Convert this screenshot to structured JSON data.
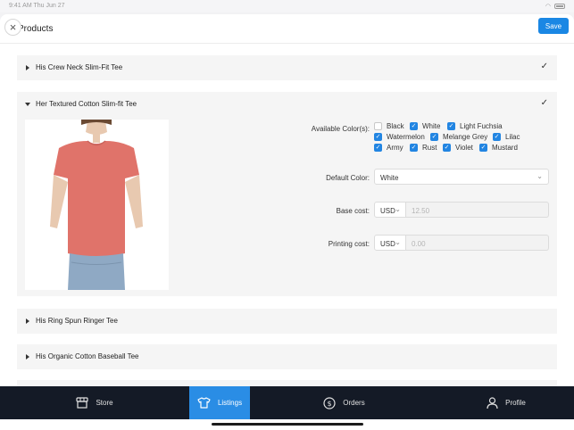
{
  "status_bar": {
    "time": "9:41 AM   Thu Jun 27"
  },
  "header": {
    "title": "Products",
    "save_label": "Save"
  },
  "products": [
    {
      "name": "His Crew Neck Slim-Fit Tee",
      "expanded": false,
      "selected": true
    },
    {
      "name": "Her Textured Cotton Slim-fit Tee",
      "expanded": true,
      "selected": true
    },
    {
      "name": "His Ring Spun Ringer Tee",
      "expanded": false,
      "selected": false
    },
    {
      "name": "His Organic Cotton Baseball Tee",
      "expanded": false,
      "selected": false
    }
  ],
  "detail": {
    "colors_label": "Available Color(s):",
    "colors": [
      {
        "name": "Black",
        "checked": false
      },
      {
        "name": "White",
        "checked": true
      },
      {
        "name": "Light Fuchsia",
        "checked": true
      },
      {
        "name": "Watermelon",
        "checked": true
      },
      {
        "name": "Melange Grey",
        "checked": true
      },
      {
        "name": "Lilac",
        "checked": true
      },
      {
        "name": "Army",
        "checked": true
      },
      {
        "name": "Rust",
        "checked": true
      },
      {
        "name": "Violet",
        "checked": true
      },
      {
        "name": "Mustard",
        "checked": true
      }
    ],
    "default_color_label": "Default Color:",
    "default_color_value": "White",
    "base_cost_label": "Base cost:",
    "base_cost_currency": "USD",
    "base_cost_value": "12.50",
    "printing_cost_label": "Printing cost:",
    "printing_cost_currency": "USD",
    "printing_cost_value": "0.00"
  },
  "tabbar": {
    "store": "Store",
    "listings": "Listings",
    "orders": "Orders",
    "profile": "Profile",
    "active": "listings"
  },
  "colors": {
    "accent": "#2285e2",
    "tabbar_bg": "#141a26",
    "shirt": "#e0736a"
  }
}
